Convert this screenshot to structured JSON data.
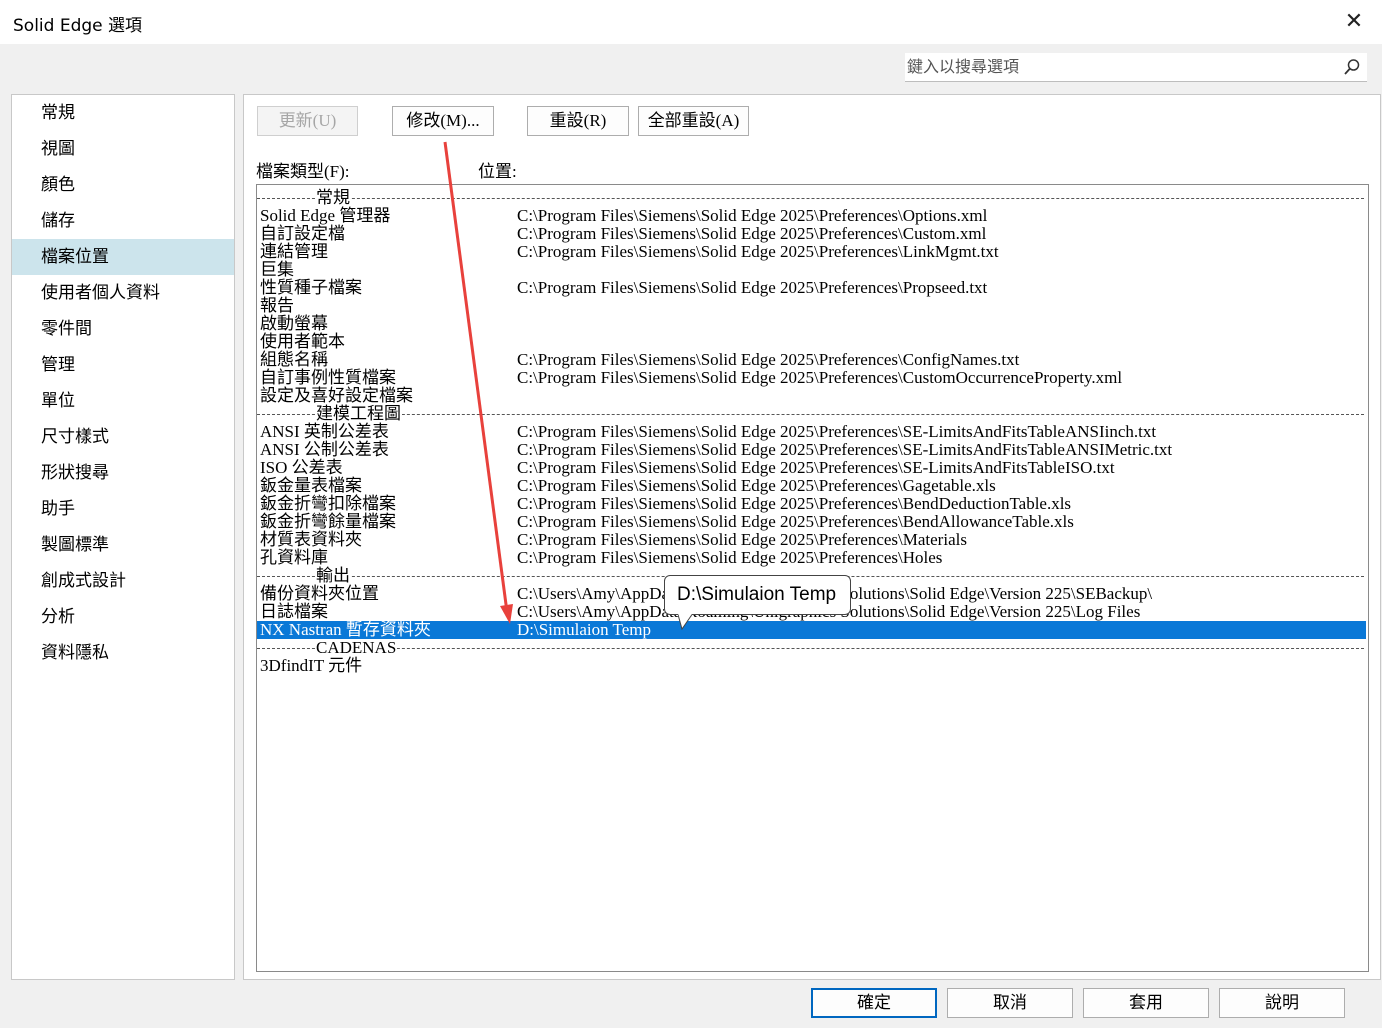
{
  "window": {
    "title": "Solid Edge 選項",
    "close_glyph": "✕"
  },
  "search": {
    "placeholder": "鍵入以搜尋選項",
    "icon": "search-icon"
  },
  "sidebar": {
    "selected_index": 4,
    "items": [
      {
        "label": "常規"
      },
      {
        "label": "視圖"
      },
      {
        "label": "顏色"
      },
      {
        "label": "儲存"
      },
      {
        "label": "檔案位置"
      },
      {
        "label": "使用者個人資料"
      },
      {
        "label": "零件間"
      },
      {
        "label": "管理"
      },
      {
        "label": "單位"
      },
      {
        "label": "尺寸樣式"
      },
      {
        "label": "形狀搜尋"
      },
      {
        "label": "助手"
      },
      {
        "label": "製圖標準"
      },
      {
        "label": "創成式設計"
      },
      {
        "label": "分析"
      },
      {
        "label": "資料隱私"
      }
    ]
  },
  "toolbar": {
    "update_label": "更新(U)",
    "modify_label": "修改(M)...",
    "reset_label": "重設(R)",
    "reset_all_label": "全部重設(A)"
  },
  "labels": {
    "file_type": "檔案類型(F):",
    "location": "位置:"
  },
  "file_list": {
    "rows": [
      {
        "section": "常規"
      },
      {
        "name": "Solid Edge 管理器",
        "path": "C:\\Program Files\\Siemens\\Solid Edge 2025\\Preferences\\Options.xml"
      },
      {
        "name": "自訂設定檔",
        "path": "C:\\Program Files\\Siemens\\Solid Edge 2025\\Preferences\\Custom.xml"
      },
      {
        "name": "連結管理",
        "path": "C:\\Program Files\\Siemens\\Solid Edge 2025\\Preferences\\LinkMgmt.txt"
      },
      {
        "name": "巨集",
        "path": ""
      },
      {
        "name": "性質種子檔案",
        "path": "C:\\Program Files\\Siemens\\Solid Edge 2025\\Preferences\\Propseed.txt"
      },
      {
        "name": "報告",
        "path": ""
      },
      {
        "name": "啟動螢幕",
        "path": ""
      },
      {
        "name": "使用者範本",
        "path": ""
      },
      {
        "name": "組態名稱",
        "path": "C:\\Program Files\\Siemens\\Solid Edge 2025\\Preferences\\ConfigNames.txt"
      },
      {
        "name": "自訂事例性質檔案",
        "path": "C:\\Program Files\\Siemens\\Solid Edge 2025\\Preferences\\CustomOccurrenceProperty.xml"
      },
      {
        "name": "設定及喜好設定檔案",
        "path": ""
      },
      {
        "section": "建模工程圖"
      },
      {
        "name": "ANSI 英制公差表",
        "path": "C:\\Program Files\\Siemens\\Solid Edge 2025\\Preferences\\SE-LimitsAndFitsTableANSIinch.txt"
      },
      {
        "name": "ANSI 公制公差表",
        "path": "C:\\Program Files\\Siemens\\Solid Edge 2025\\Preferences\\SE-LimitsAndFitsTableANSIMetric.txt"
      },
      {
        "name": "ISO 公差表",
        "path": "C:\\Program Files\\Siemens\\Solid Edge 2025\\Preferences\\SE-LimitsAndFitsTableISO.txt"
      },
      {
        "name": "鈑金量表檔案",
        "path": "C:\\Program Files\\Siemens\\Solid Edge 2025\\Preferences\\Gagetable.xls"
      },
      {
        "name": "鈑金折彎扣除檔案",
        "path": "C:\\Program Files\\Siemens\\Solid Edge 2025\\Preferences\\BendDeductionTable.xls"
      },
      {
        "name": "鈑金折彎餘量檔案",
        "path": "C:\\Program Files\\Siemens\\Solid Edge 2025\\Preferences\\BendAllowanceTable.xls"
      },
      {
        "name": "材質表資料夾",
        "path": "C:\\Program Files\\Siemens\\Solid Edge 2025\\Preferences\\Materials"
      },
      {
        "name": "孔資料庫",
        "path": "C:\\Program Files\\Siemens\\Solid Edge 2025\\Preferences\\Holes"
      },
      {
        "section": "輸出"
      },
      {
        "name": "備份資料夾位置",
        "path": "C:\\Users\\Amy\\AppData\\Roaming\\Unigraphics Solutions\\Solid Edge\\Version 225\\SEBackup\\"
      },
      {
        "name": "日誌檔案",
        "path": "C:\\Users\\Amy\\AppData\\Roaming\\Unigraphics Solutions\\Solid Edge\\Version 225\\Log Files"
      },
      {
        "name": "NX Nastran 暫存資料夾",
        "path": "D:\\Simulaion Temp",
        "selected": true
      },
      {
        "section": "CADENAS"
      },
      {
        "name": "3DfindIT 元件",
        "path": ""
      }
    ]
  },
  "tooltip": {
    "text": "D:\\Simulaion Temp"
  },
  "annotation": {
    "arrow_color": "#e8413c"
  },
  "footer": {
    "ok_label": "確定",
    "cancel_label": "取消",
    "apply_label": "套用",
    "help_label": "說明"
  },
  "colors": {
    "selection": "#0a78d7",
    "sidebar_selected": "#cce4ec"
  }
}
